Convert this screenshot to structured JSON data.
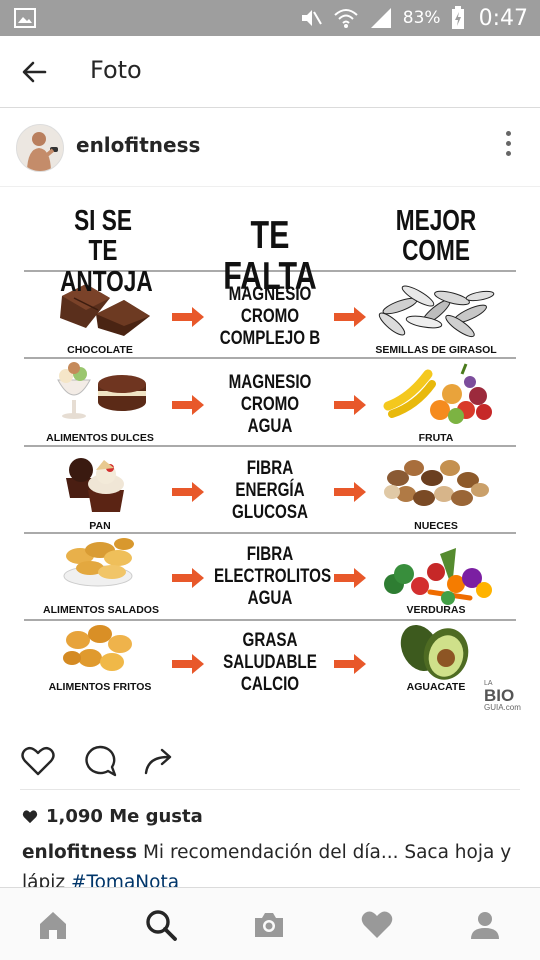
{
  "status_bar": {
    "battery_percent": "83%",
    "time": "0:47",
    "icons": [
      "gallery-icon",
      "mute-icon",
      "wifi-icon",
      "signal-icon",
      "battery-charging-icon"
    ]
  },
  "app_bar": {
    "title": "Foto",
    "back_icon": "arrow-left-icon"
  },
  "post": {
    "username": "enlofitness",
    "more_icon": "vertical-dots-icon"
  },
  "infographic": {
    "columns": {
      "left": [
        "SI SE TE",
        "ANTOJA"
      ],
      "middle": "TE FALTA",
      "right": [
        "MEJOR",
        "COME"
      ]
    },
    "rows": [
      {
        "craving": "CHOCOLATE",
        "lacking": [
          "MAGNESIO",
          "CROMO",
          "COMPLEJO B"
        ],
        "eat": "SEMILLAS DE GIRASOL"
      },
      {
        "craving": "ALIMENTOS DULCES",
        "lacking": [
          "MAGNESIO",
          "CROMO",
          "AGUA"
        ],
        "eat": "FRUTA"
      },
      {
        "craving": "PAN",
        "lacking": [
          "FIBRA",
          "ENERGÍA",
          "GLUCOSA"
        ],
        "eat": "NUECES"
      },
      {
        "craving": "ALIMENTOS SALADOS",
        "lacking": [
          "FIBRA",
          "ELECTROLITOS",
          "AGUA"
        ],
        "eat": "VERDURAS"
      },
      {
        "craving": "ALIMENTOS FRITOS",
        "lacking": [
          "GRASA",
          "SALUDABLE",
          "CALCIO"
        ],
        "eat": "AGUACATE"
      }
    ],
    "logo": {
      "top": "LA",
      "main": "BIO",
      "bottom": "GUIA.com"
    },
    "arrow_color": "#e8582a"
  },
  "actions": {
    "icons": [
      "heart-outline-icon",
      "comment-icon",
      "share-icon"
    ]
  },
  "likes": {
    "text": "1,090 Me gusta"
  },
  "caption": {
    "username": "enlofitness",
    "text": " Mi recomendación del día... Saca hoja y lápiz ",
    "hashtag": "#TomaNota"
  },
  "bottom_nav": {
    "icons": [
      "home-icon",
      "search-icon",
      "camera-icon",
      "heart-icon",
      "profile-icon"
    ]
  }
}
